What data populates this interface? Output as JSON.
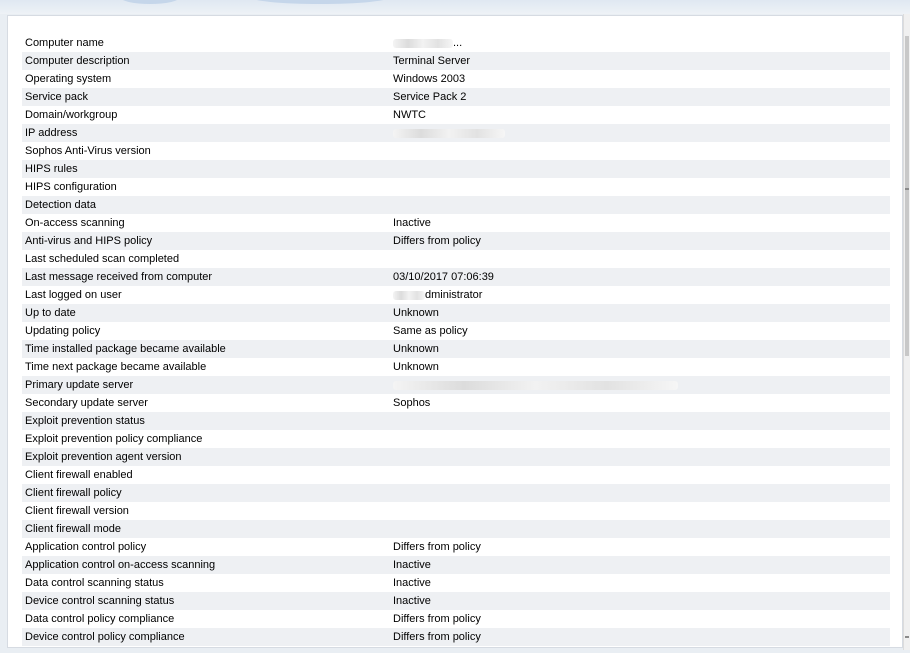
{
  "properties": [
    {
      "label": "Computer name",
      "value": "...",
      "redacted": true
    },
    {
      "label": "Computer description",
      "value": "Terminal Server"
    },
    {
      "label": "Operating system",
      "value": "Windows 2003"
    },
    {
      "label": "Service pack",
      "value": "Service Pack 2"
    },
    {
      "label": "Domain/workgroup",
      "value": "NWTC"
    },
    {
      "label": "IP address",
      "value": "",
      "redacted": true
    },
    {
      "label": "Sophos Anti-Virus version",
      "value": ""
    },
    {
      "label": "HIPS rules",
      "value": ""
    },
    {
      "label": "HIPS configuration",
      "value": ""
    },
    {
      "label": "Detection data",
      "value": ""
    },
    {
      "label": "On-access scanning",
      "value": "Inactive"
    },
    {
      "label": "Anti-virus and HIPS policy",
      "value": "Differs from policy"
    },
    {
      "label": "Last scheduled scan completed",
      "value": ""
    },
    {
      "label": "Last message received from computer",
      "value": "03/10/2017 07:06:39"
    },
    {
      "label": "Last logged on user",
      "value": "dministrator",
      "redacted": true
    },
    {
      "label": "Up to date",
      "value": "Unknown"
    },
    {
      "label": "Updating policy",
      "value": "Same as policy"
    },
    {
      "label": "Time installed package became available",
      "value": "Unknown"
    },
    {
      "label": "Time next package became available",
      "value": "Unknown"
    },
    {
      "label": "Primary update server",
      "value": "",
      "redacted": true
    },
    {
      "label": "Secondary update server",
      "value": "Sophos"
    },
    {
      "label": "Exploit prevention status",
      "value": ""
    },
    {
      "label": "Exploit prevention policy compliance",
      "value": ""
    },
    {
      "label": "Exploit prevention agent version",
      "value": ""
    },
    {
      "label": "Client firewall enabled",
      "value": ""
    },
    {
      "label": "Client firewall policy",
      "value": ""
    },
    {
      "label": "Client firewall version",
      "value": ""
    },
    {
      "label": "Client firewall mode",
      "value": ""
    },
    {
      "label": "Application control policy",
      "value": "Differs from policy"
    },
    {
      "label": "Application control on-access scanning",
      "value": "Inactive"
    },
    {
      "label": "Data control scanning status",
      "value": "Inactive"
    },
    {
      "label": "Device control scanning status",
      "value": "Inactive"
    },
    {
      "label": "Data control policy compliance",
      "value": "Differs from policy"
    },
    {
      "label": "Device control policy compliance",
      "value": "Differs from policy"
    }
  ]
}
